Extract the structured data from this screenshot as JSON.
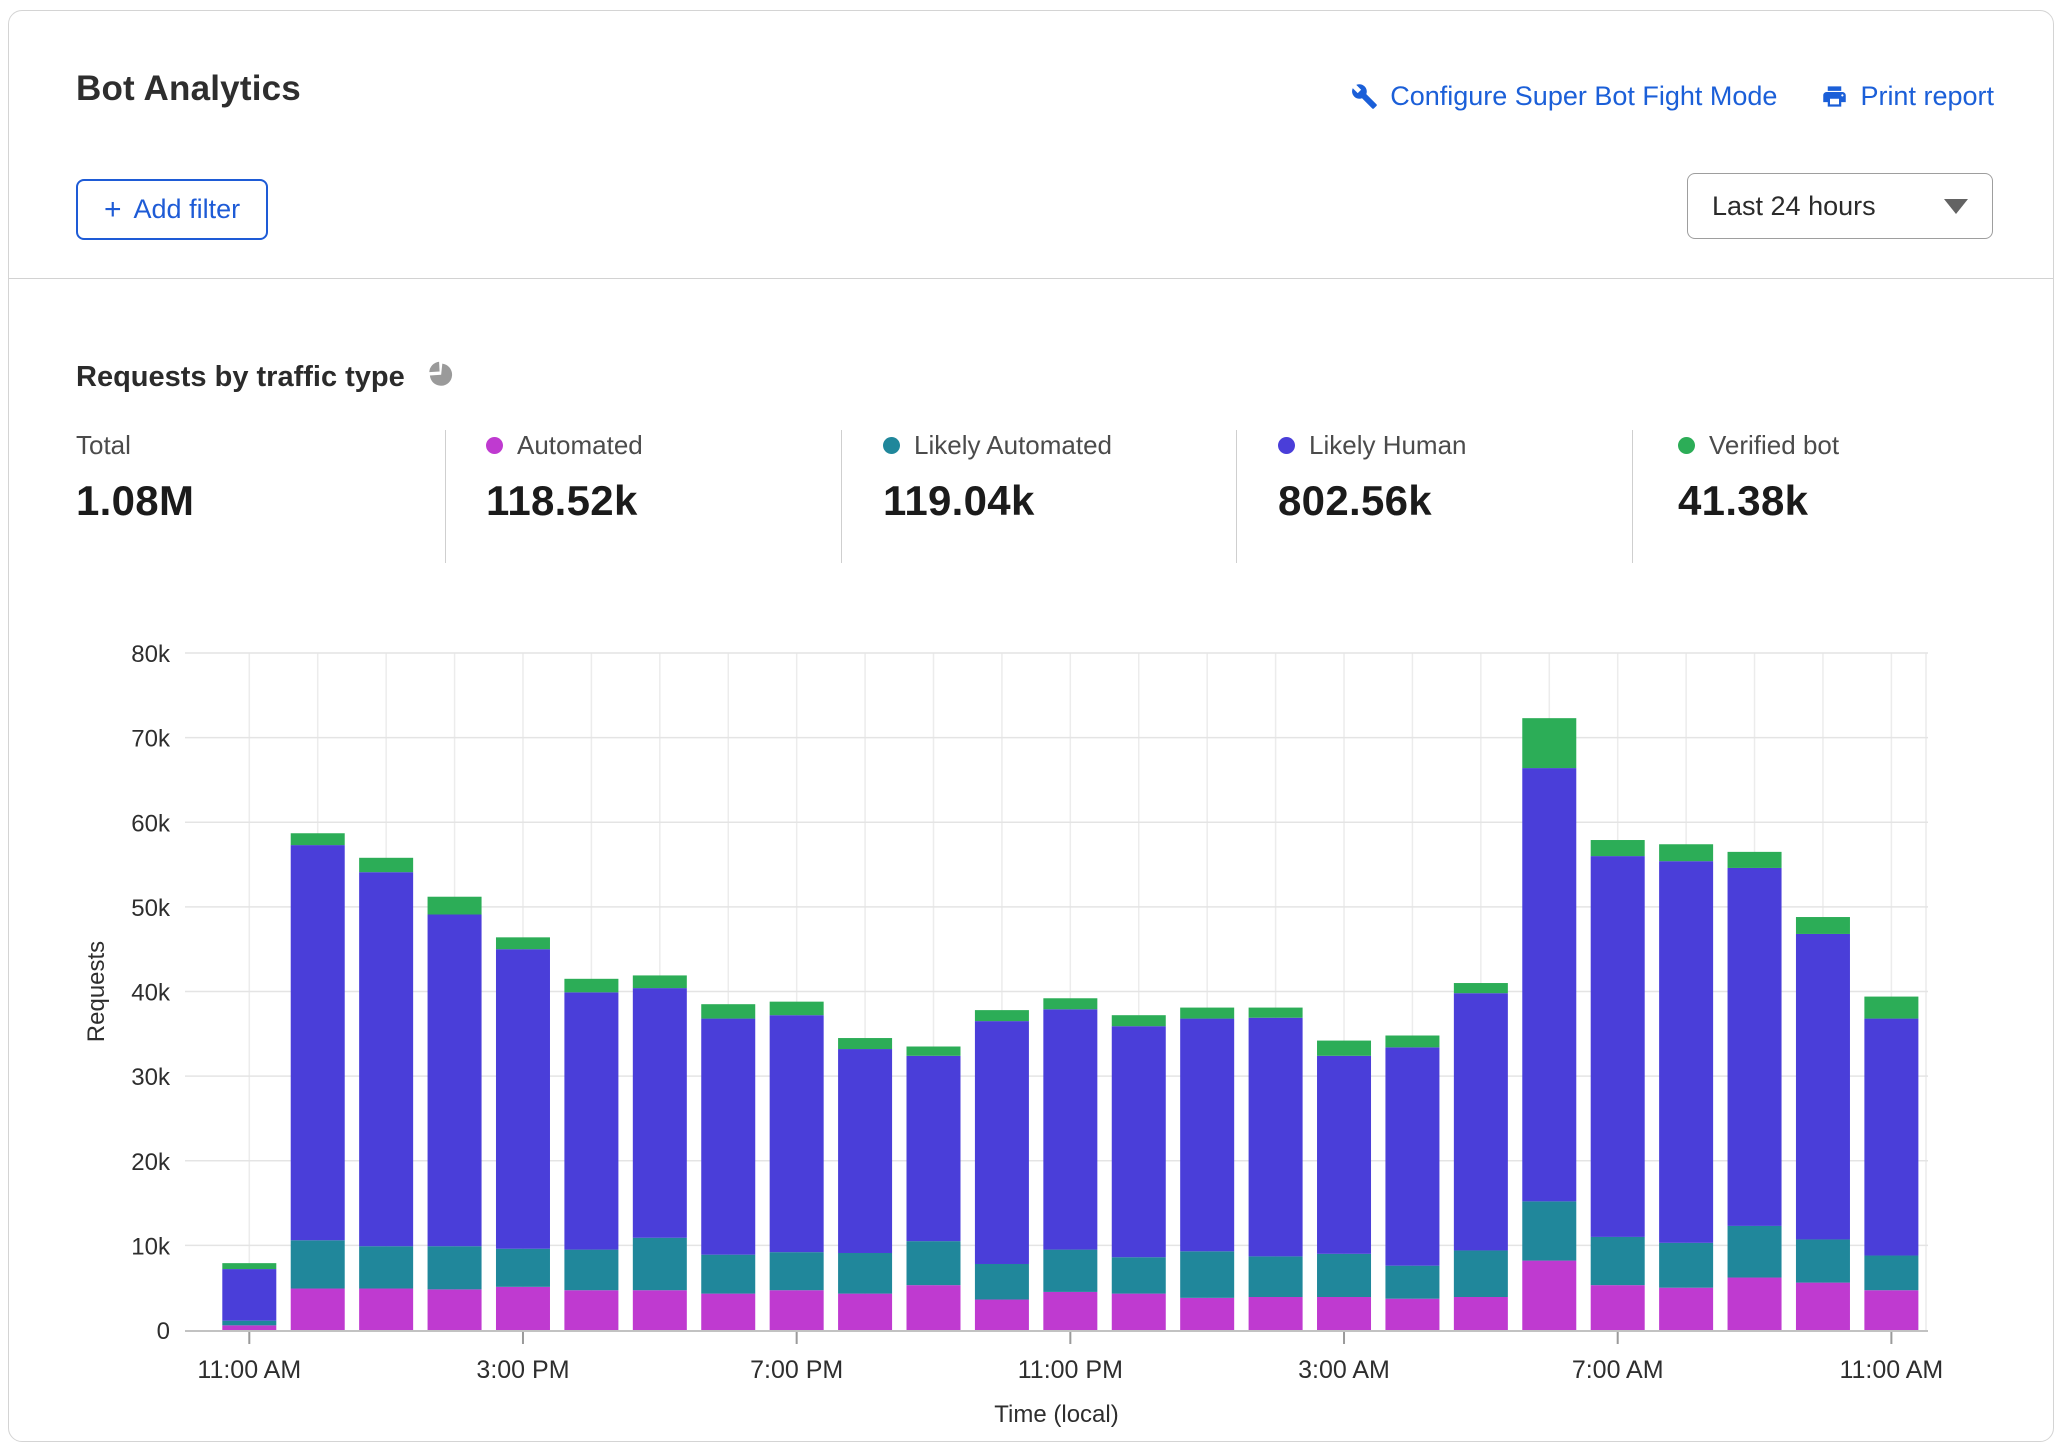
{
  "card": {
    "title": "Bot Analytics",
    "actions": {
      "configure_label": "Configure Super Bot Fight Mode",
      "print_label": "Print report"
    },
    "filter": {
      "icon": "+",
      "label": "Add filter"
    },
    "time_range": {
      "selected": "Last 24 hours"
    }
  },
  "section": {
    "title": "Requests by traffic type"
  },
  "stats": [
    {
      "label": "Total",
      "value": "1.08M",
      "color": ""
    },
    {
      "label": "Automated",
      "value": "118.52k",
      "color": "#bf3ad0"
    },
    {
      "label": "Likely Automated",
      "value": "119.04k",
      "color": "#20879b"
    },
    {
      "label": "Likely Human",
      "value": "802.56k",
      "color": "#4a3ed9"
    },
    {
      "label": "Verified bot",
      "value": "41.38k",
      "color": "#2cad57"
    }
  ],
  "chart_data": {
    "type": "bar",
    "stacked": true,
    "title": "Requests by traffic type",
    "unit": "thousands of requests",
    "xlabel": "Time (local)",
    "ylabel": "Requests",
    "ylim": [
      0,
      80
    ],
    "grid": true,
    "y_ticks": [
      "0",
      "10k",
      "20k",
      "30k",
      "40k",
      "50k",
      "60k",
      "70k",
      "80k"
    ],
    "x": [
      "11:00 AM",
      "12:00 PM",
      "1:00 PM",
      "2:00 PM",
      "3:00 PM",
      "4:00 PM",
      "5:00 PM",
      "6:00 PM",
      "7:00 PM",
      "8:00 PM",
      "9:00 PM",
      "10:00 PM",
      "11:00 PM",
      "12:00 AM",
      "1:00 AM",
      "2:00 AM",
      "3:00 AM",
      "4:00 AM",
      "5:00 AM",
      "6:00 AM",
      "7:00 AM",
      "8:00 AM",
      "9:00 AM",
      "10:00 AM",
      "11:00 AM"
    ],
    "x_tick_indices": [
      0,
      4,
      8,
      12,
      16,
      20,
      24
    ],
    "x_tick_labels": [
      "11:00 AM",
      "3:00 PM",
      "7:00 PM",
      "11:00 PM",
      "3:00 AM",
      "7:00 AM",
      "11:00 AM"
    ],
    "series": [
      {
        "name": "Automated",
        "color": "#bf3ad0",
        "values": [
          0.55,
          4.9,
          4.9,
          4.8,
          5.1,
          4.7,
          4.7,
          4.3,
          4.7,
          4.3,
          5.3,
          3.6,
          4.5,
          4.3,
          3.8,
          3.9,
          3.9,
          3.7,
          3.9,
          8.2,
          5.3,
          5.0,
          6.2,
          5.6,
          4.7
        ]
      },
      {
        "name": "Likely Automated",
        "color": "#20879b",
        "values": [
          0.55,
          5.7,
          5.0,
          5.1,
          4.5,
          4.8,
          6.2,
          4.6,
          4.5,
          4.8,
          5.2,
          4.2,
          5.0,
          4.3,
          5.5,
          4.8,
          5.1,
          3.9,
          5.5,
          7.0,
          5.7,
          5.3,
          6.1,
          5.1,
          4.1
        ]
      },
      {
        "name": "Likely Human",
        "color": "#4a3ed9",
        "values": [
          6.1,
          46.7,
          44.2,
          39.2,
          35.4,
          30.4,
          29.5,
          27.9,
          28.0,
          24.1,
          21.9,
          28.7,
          28.4,
          27.3,
          27.5,
          28.2,
          23.4,
          25.8,
          30.4,
          51.2,
          45.0,
          45.1,
          42.3,
          36.1,
          28.0
        ]
      },
      {
        "name": "Verified bot",
        "color": "#2cad57",
        "values": [
          0.7,
          1.4,
          1.7,
          2.1,
          1.4,
          1.6,
          1.5,
          1.7,
          1.6,
          1.3,
          1.1,
          1.3,
          1.3,
          1.3,
          1.3,
          1.2,
          1.8,
          1.4,
          1.2,
          5.9,
          1.9,
          2.0,
          1.9,
          2.0,
          2.6
        ]
      }
    ],
    "legend_position": "top stats row"
  }
}
